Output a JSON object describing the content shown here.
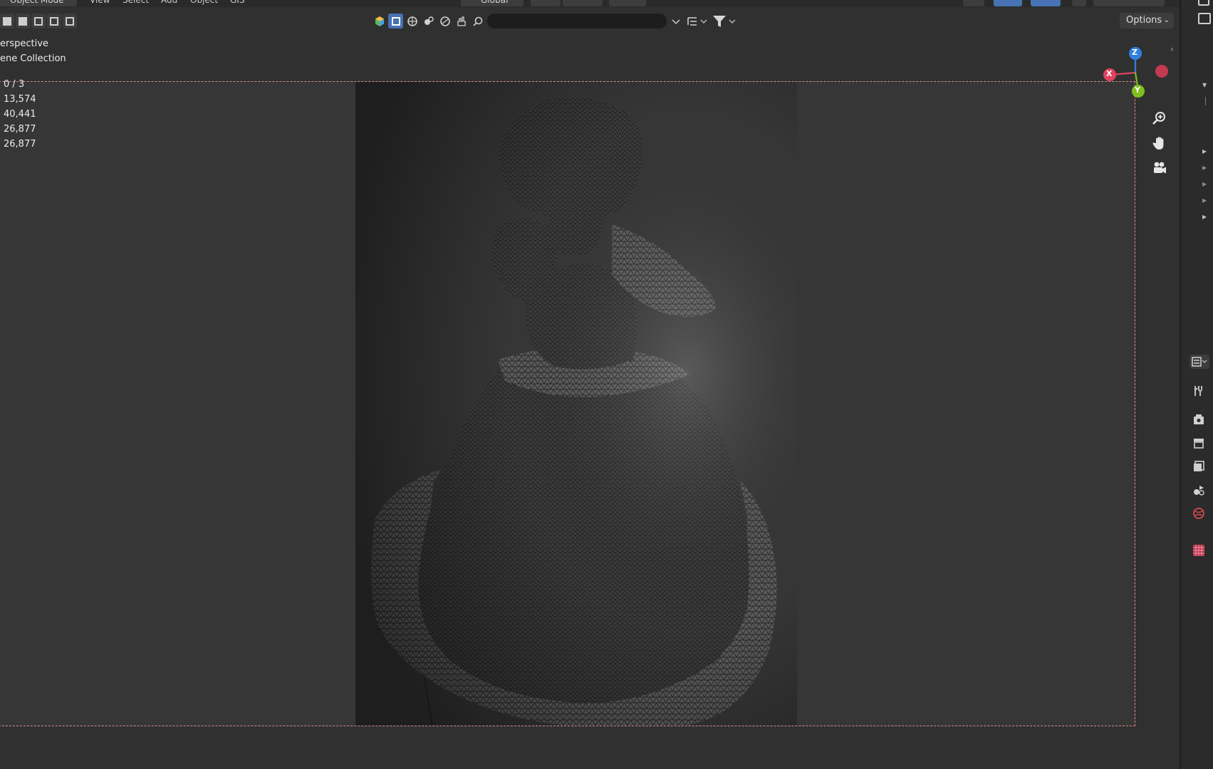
{
  "menubar": {
    "mode_label": "Object Mode",
    "menus": [
      "View",
      "Select",
      "Add",
      "Object",
      "GIS"
    ],
    "orientation_label": "Global"
  },
  "header": {
    "options_label": "Options",
    "search_placeholder": ""
  },
  "viewport": {
    "view_name": "erspective",
    "collection": "ene Collection",
    "stats": [
      "0 / 3",
      "13,574",
      "40,441",
      "26,877",
      "26,877"
    ]
  },
  "gizmo": {
    "z_label": "Z",
    "x_label": "X",
    "y_label": "Y",
    "colors": {
      "x": "#e0425f",
      "y": "#7fbf1f",
      "z": "#2f7fe0",
      "neg_x": "#c23a4f"
    }
  },
  "icons": {
    "zoom": "zoom-in-icon",
    "pan": "hand-pan-icon",
    "camera": "camera-view-icon"
  }
}
